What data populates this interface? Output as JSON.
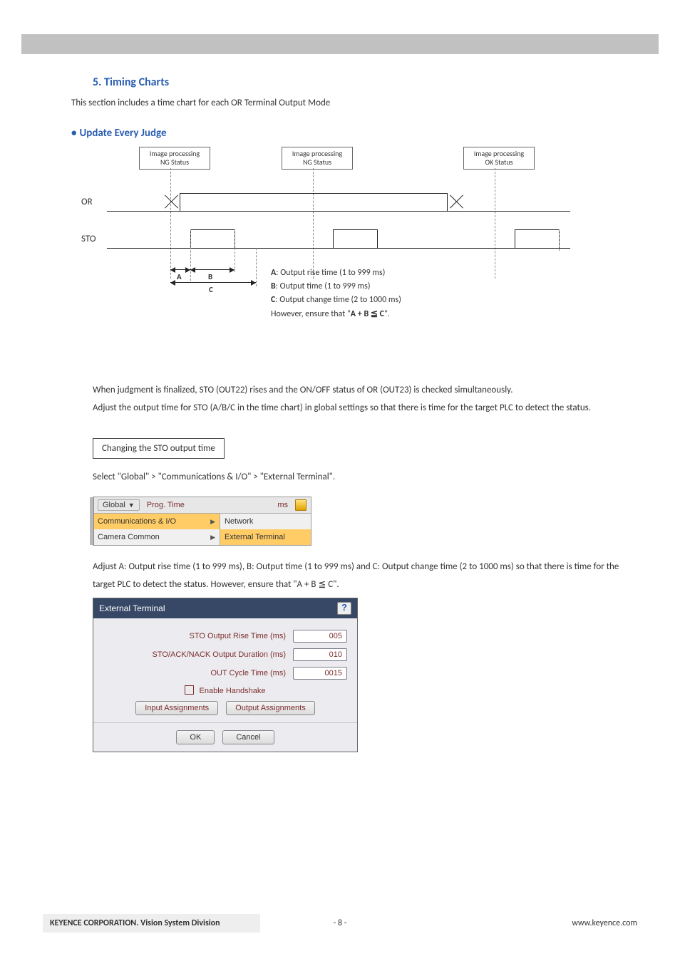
{
  "section": {
    "number": "5.",
    "title": "Timing Charts",
    "intro": "This section includes a time chart for each OR Terminal Output Mode"
  },
  "subsection": {
    "bullet": "•",
    "title": "Update Every Judge"
  },
  "diagram": {
    "row_or": "OR",
    "row_sto": "STO",
    "box1_l1": "Image processing",
    "box1_l2": "NG Status",
    "box2_l1": "Image processing",
    "box2_l2": "NG Status",
    "box3_l1": "Image processing",
    "box3_l2": "OK Status",
    "dim_a": "A",
    "dim_b": "B",
    "dim_c": "C",
    "note_a": "A: Output rise time (1 to 999 ms)",
    "note_b": "B: Output time (1 to 999 ms)",
    "note_c": "C: Output change time (2 to 1000 ms)",
    "note_d_pre": "However, ensure that \"",
    "note_d_bold": "A + B ≦ C",
    "note_d_post": "\"."
  },
  "para_after_diagram": {
    "l1": "When judgment is finalized, STO (OUT22) rises and the ON/OFF status of OR (OUT23) is checked simultaneously.",
    "l2": "Adjust the output time for STO (A/B/C in the time chart) in global settings so that there is time for the target PLC to detect the status."
  },
  "step_box": "Changing the STO output time",
  "nav_instruction": "Select \"Global\" > \"Communications & I/O\" > \"External Terminal\".",
  "menu": {
    "global_btn": "Global",
    "col2_label": "Prog. Time",
    "ms": "ms",
    "row1": "Communications & I/O",
    "row1b": "Network",
    "row2": "Camera Common",
    "row2b": "External Terminal"
  },
  "adjust_para": {
    "text": "Adjust A: Output rise time (1 to 999 ms), B: Output time (1 to 999 ms) and C: Output change time (2 to 1000 ms) so that there is time for the target PLC to detect the status. However, ensure that \"A + B ≦ C\"."
  },
  "dialog": {
    "title": "External Terminal",
    "f1_label": "STO Output Rise Time (ms)",
    "f1_value": "005",
    "f2_label": "STO/ACK/NACK Output Duration (ms)",
    "f2_value": "010",
    "f3_label": "OUT Cycle Time (ms)",
    "f3_value": "0015",
    "chk": "Enable Handshake",
    "btn_in": "Input Assignments",
    "btn_out": "Output Assignments",
    "ok": "OK",
    "cancel": "Cancel"
  },
  "footer": {
    "left": "KEYENCE CORPORATION. Vision System Division",
    "center": "- 8 -",
    "right": "www.keyence.com"
  }
}
